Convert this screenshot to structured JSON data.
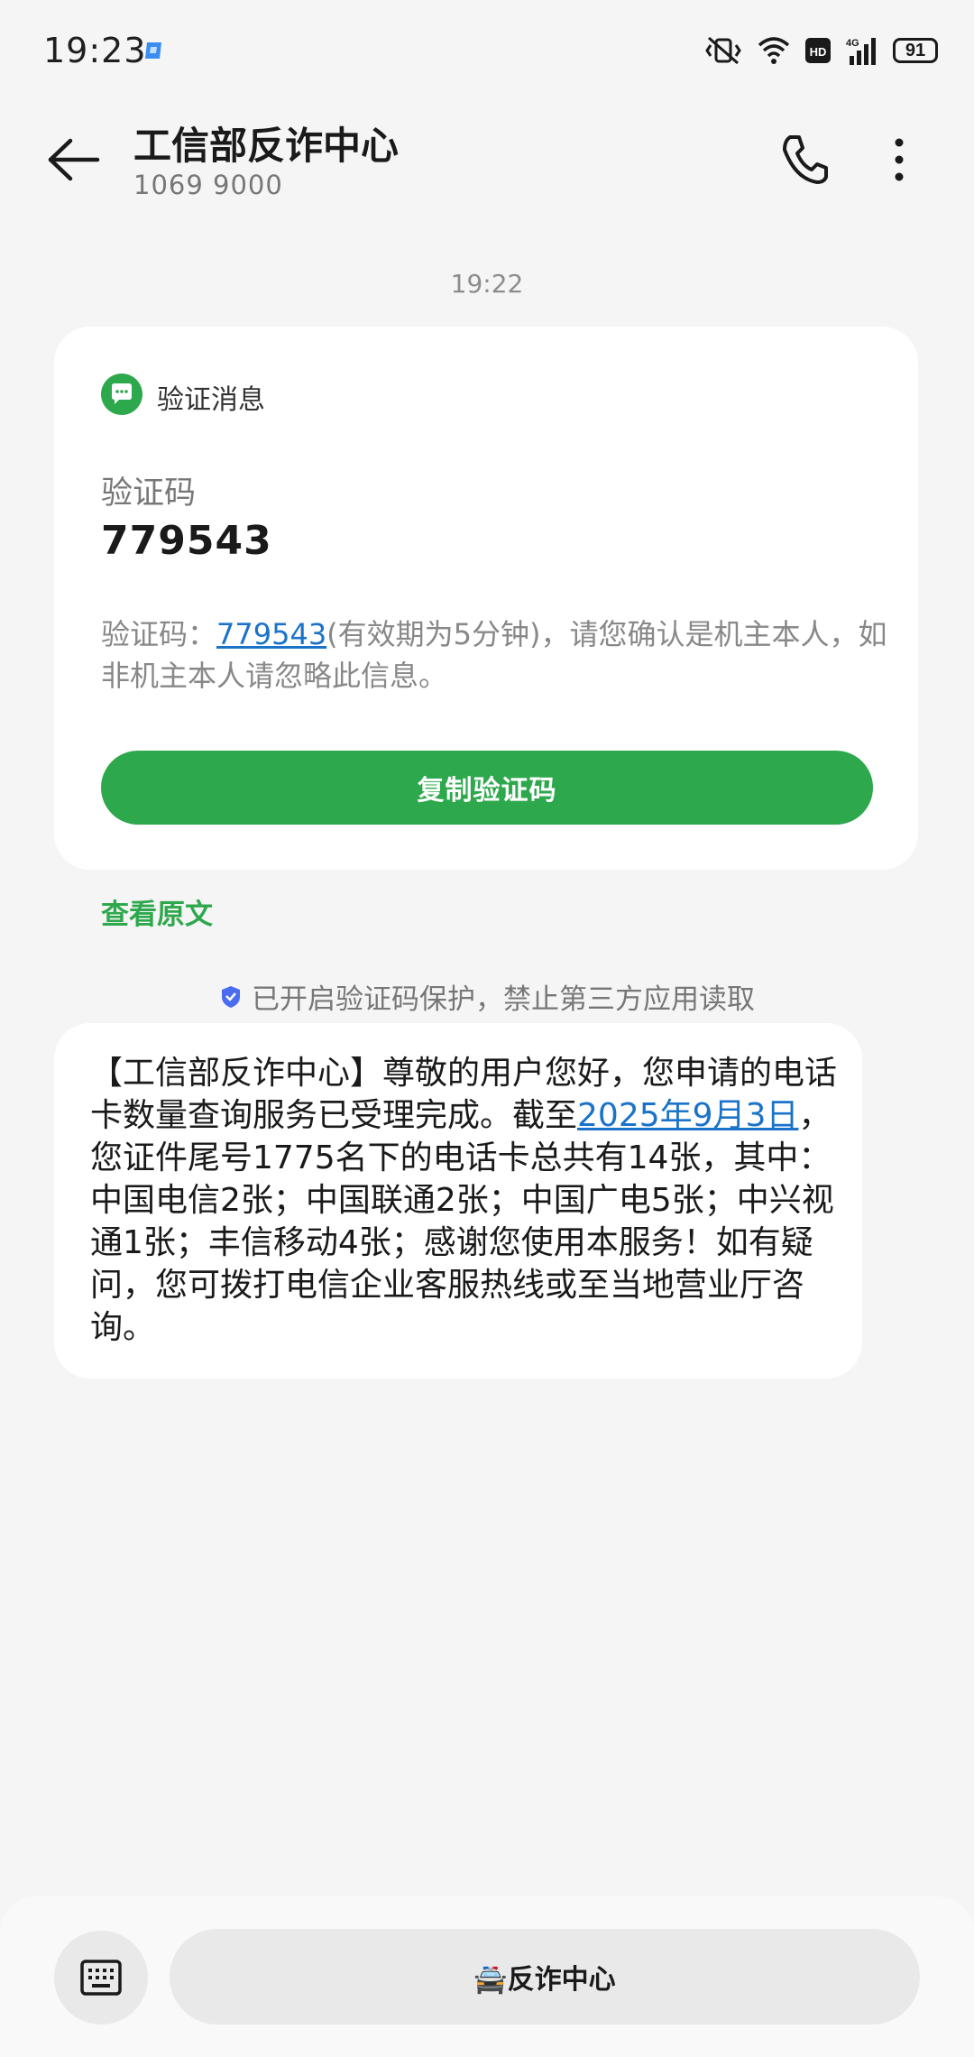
{
  "status_bar": {
    "time": "19:23",
    "battery": "91"
  },
  "header": {
    "title": "工信部反诈中心",
    "subtitle": "1069 9000"
  },
  "messages": {
    "time": "19:22",
    "verification_card": {
      "badge_label": "验证消息",
      "code_label": "验证码",
      "code_value": "779543",
      "desc_prefix": "验证码：",
      "desc_code_link": "779543",
      "desc_suffix": "(有效期为5分钟)，请您确认是机主本人，如非机主本人请忽略此信息。",
      "copy_button": "复制验证码"
    },
    "view_original": "查看原文",
    "protection_notice": "已开启验证码保护，禁止第三方应用读取",
    "sms": {
      "text_before_link": "【工信部反诈中心】尊敬的用户您好，您申请的电话卡数量查询服务已受理完成。截至",
      "date_link": "2025年9月3日",
      "text_after_link": "，您证件尾号1775名下的电话卡总共有14张，其中：中国电信2张；中国联通2张；中国广电5张；中兴视通1张；丰信移动4张；感谢您使用本服务！如有疑问，您可拨打电信企业客服热线或至当地营业厅咨询。"
    }
  },
  "bottom_bar": {
    "menu_label": "🚔反诈中心"
  }
}
